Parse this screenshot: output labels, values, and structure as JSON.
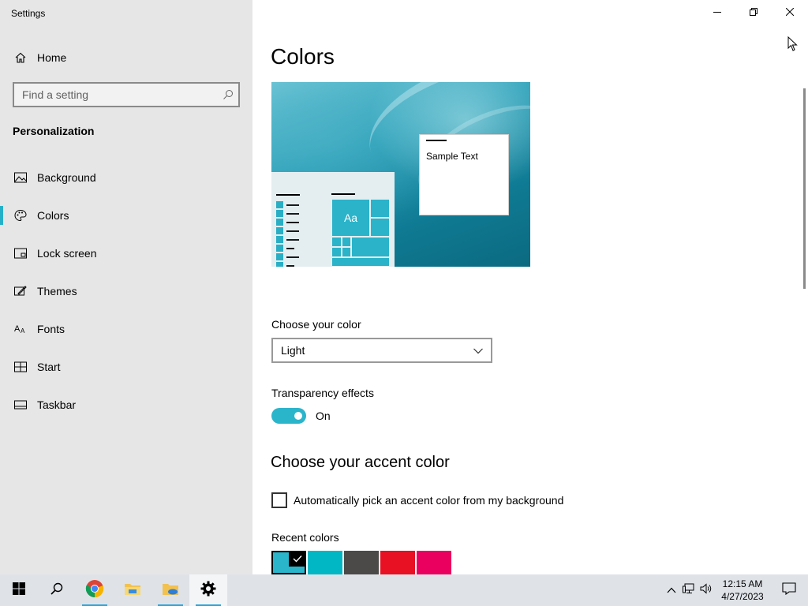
{
  "window": {
    "title": "Settings",
    "controls": {
      "minimize_icon": "minimize-icon",
      "restore_icon": "restore-icon",
      "close_icon": "close-icon"
    }
  },
  "sidebar": {
    "home_label": "Home",
    "search_placeholder": "Find a setting",
    "section_title": "Personalization",
    "items": [
      {
        "label": "Background",
        "icon": "picture-icon",
        "active": false
      },
      {
        "label": "Colors",
        "icon": "palette-icon",
        "active": true
      },
      {
        "label": "Lock screen",
        "icon": "lock-screen-icon",
        "active": false
      },
      {
        "label": "Themes",
        "icon": "themes-icon",
        "active": false
      },
      {
        "label": "Fonts",
        "icon": "fonts-icon",
        "active": false
      },
      {
        "label": "Start",
        "icon": "start-icon",
        "active": false
      },
      {
        "label": "Taskbar",
        "icon": "taskbar-icon",
        "active": false
      }
    ]
  },
  "main": {
    "title": "Colors",
    "preview": {
      "sample_text": "Sample Text",
      "tile_text": "Aa"
    },
    "choose_color_label": "Choose your color",
    "choose_color_value": "Light",
    "transparency_label": "Transparency effects",
    "transparency_state": "On",
    "accent_heading": "Choose your accent color",
    "auto_accent_label": "Automatically pick an accent color from my background",
    "recent_colors_label": "Recent colors",
    "recent_colors": [
      "#2bb5cb",
      "#00b7c3",
      "#4c4a48",
      "#e81123",
      "#ea005e"
    ],
    "accent_color": "#2bb5cb"
  },
  "taskbar": {
    "apps": [
      "start-icon",
      "search-icon",
      "chrome-icon",
      "file-explorer-icon",
      "onedrive-folder-icon",
      "settings-gear-icon"
    ],
    "time": "12:15 AM",
    "date": "4/27/2023"
  }
}
